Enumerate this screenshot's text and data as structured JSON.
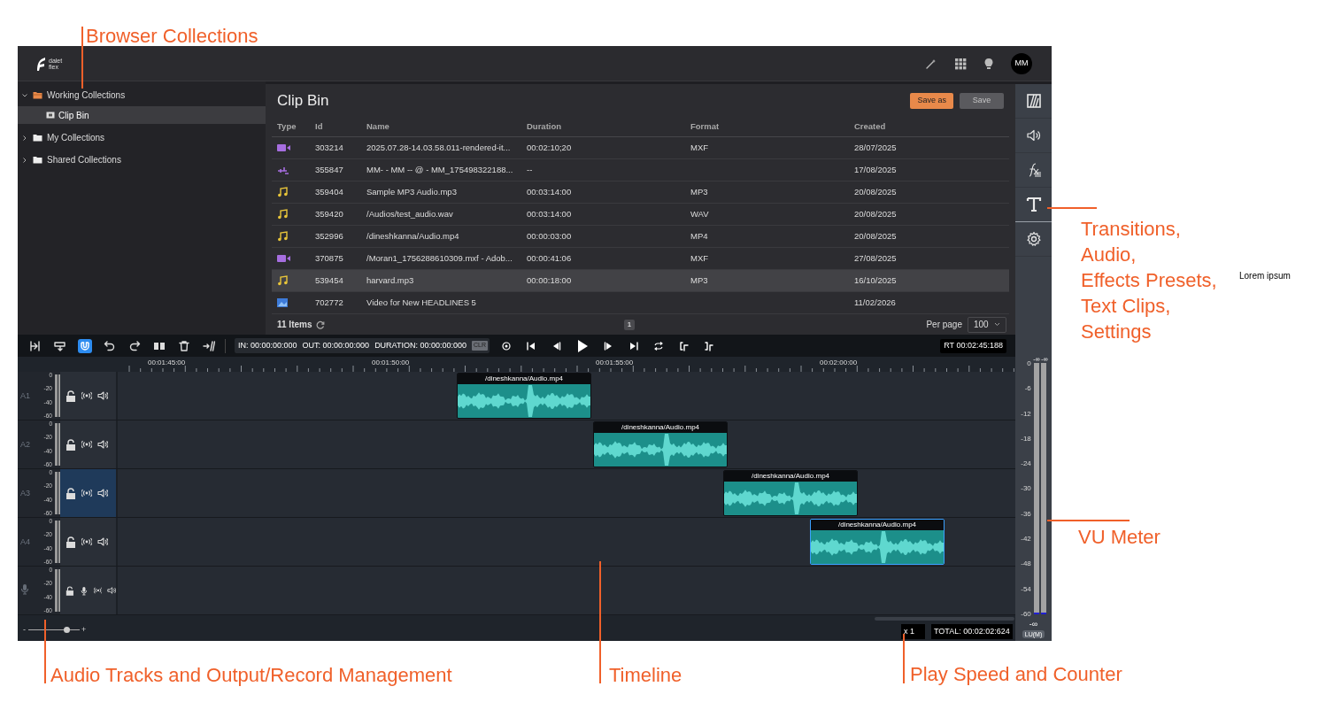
{
  "header": {
    "logo": {
      "line_1": "dalet",
      "line_2": "flex"
    },
    "avatar": "MM"
  },
  "sidebar": {
    "items": [
      {
        "label": "Working Collections",
        "expanded": true,
        "selected": false,
        "children": [
          {
            "label": "Clip Bin",
            "selected": true
          }
        ]
      },
      {
        "label": "My Collections",
        "expanded": false,
        "selected": false
      },
      {
        "label": "Shared Collections",
        "expanded": false,
        "selected": false
      }
    ]
  },
  "clip_bin": {
    "title": "Clip Bin",
    "buttons": [
      {
        "label": "Save as",
        "disabled": false
      },
      {
        "label": "Save",
        "disabled": true
      }
    ],
    "table": {
      "columns": [
        "Type",
        "Id",
        "Name",
        "Duration",
        "Format",
        "Created"
      ],
      "rows": [
        {
          "kind": "video",
          "id": "303214",
          "name": "2025.07.28-14.03.58.011-rendered-it...",
          "duration": "00:02:10;20",
          "format": "MXF",
          "created": "28/07/2025",
          "selected": false
        },
        {
          "kind": "sequence",
          "id": "355847",
          "name": "MM- - MM -- @ - MM_175498322188...",
          "duration": "--",
          "format": "",
          "created": "17/08/2025",
          "selected": false
        },
        {
          "kind": "audio",
          "id": "359404",
          "name": "Sample MP3 Audio.mp3",
          "duration": "00:03:14:00",
          "format": "MP3",
          "created": "20/08/2025",
          "selected": false
        },
        {
          "kind": "audio",
          "id": "359420",
          "name": "/Audios/test_audio.wav",
          "duration": "00:03:14:00",
          "format": "WAV",
          "created": "20/08/2025",
          "selected": false
        },
        {
          "kind": "audio",
          "id": "352996",
          "name": "/dineshkanna/Audio.mp4",
          "duration": "00:00:03:00",
          "format": "MP4",
          "created": "20/08/2025",
          "selected": false
        },
        {
          "kind": "video",
          "id": "370875",
          "name": "/Moran1_1756288610309.mxf - Adob...",
          "duration": "00:00:41:06",
          "format": "MXF",
          "created": "27/08/2025",
          "selected": false
        },
        {
          "kind": "audio",
          "id": "539454",
          "name": "harvard.mp3",
          "duration": "00:00:18:00",
          "format": "MP3",
          "created": "16/10/2025",
          "selected": true
        },
        {
          "kind": "image",
          "id": "702772",
          "name": "Video for New HEADLINES 5",
          "duration": "",
          "format": "",
          "created": "11/02/2026",
          "selected": false
        }
      ]
    },
    "footer": {
      "count": "11 Items",
      "page": "1",
      "per_page_label": "Per page",
      "per_page": "100"
    }
  },
  "toolbar": {
    "tools": [
      {
        "kind": "insert",
        "on": false
      },
      {
        "kind": "overwrite",
        "on": false
      },
      {
        "kind": "snap",
        "on": true
      },
      {
        "kind": "undo",
        "on": false
      },
      {
        "kind": "redo",
        "on": false
      },
      {
        "kind": "split",
        "on": false
      },
      {
        "kind": "delete",
        "on": false
      },
      {
        "kind": "ripple",
        "on": false
      }
    ],
    "timecode": {
      "in": "IN: 00:00:00:000",
      "out": "OUT: 00:00:00:000",
      "duration": "DURATION: 00:00:00:000",
      "clear": "CLR"
    },
    "transport": [
      {
        "kind": "record"
      },
      {
        "kind": "first"
      },
      {
        "kind": "step_back"
      },
      {
        "kind": "play"
      },
      {
        "kind": "step_forward"
      },
      {
        "kind": "last"
      },
      {
        "kind": "loop"
      },
      {
        "kind": "mark_in"
      },
      {
        "kind": "mark_out"
      }
    ],
    "rt": "RT 00:02:45:188"
  },
  "ruler": {
    "labels": [
      "00:01:45:00",
      "00:01:50:00",
      "00:01:55:00",
      "00:02:00:00"
    ]
  },
  "tracks": [
    {
      "kind": "audio",
      "label": "A1",
      "selected": false,
      "scale": [
        "0",
        "-20",
        "-40",
        "-60"
      ],
      "clips": [
        {
          "title": "/dineshkanna/Audio.mp4",
          "selected": false
        }
      ]
    },
    {
      "kind": "audio",
      "label": "A2",
      "selected": false,
      "scale": [
        "0",
        "-20",
        "-40",
        "-60"
      ],
      "clips": [
        {
          "title": "/dineshkanna/Audio.mp4",
          "selected": false
        }
      ]
    },
    {
      "kind": "audio",
      "label": "A3",
      "selected": true,
      "scale": [
        "0",
        "-20",
        "-40",
        "-60"
      ],
      "clips": [
        {
          "title": "/dineshkanna/Audio.mp4",
          "selected": false
        }
      ]
    },
    {
      "kind": "audio",
      "label": "A4",
      "selected": false,
      "scale": [
        "0",
        "-20",
        "-40",
        "-60"
      ],
      "clips": [
        {
          "title": "/dineshkanna/Audio.mp4",
          "selected": true
        }
      ]
    },
    {
      "kind": "record",
      "selected": false,
      "scale": [
        "0",
        "-20",
        "-40",
        "-60"
      ]
    }
  ],
  "bottom_bar": {
    "zoom_minus": "-",
    "zoom_level": {
      "level": 0.75
    },
    "zoom_plus": "+",
    "speed": "x 1",
    "total": "TOTAL: 00:02:02:624"
  },
  "rail": {
    "tools": [
      {
        "kind": "transitions"
      },
      {
        "kind": "audio"
      },
      {
        "kind": "effects"
      },
      {
        "kind": "text"
      },
      {
        "kind": "settings"
      }
    ]
  },
  "vu_meter": {
    "peaks": [
      "-∞",
      "-∞"
    ],
    "scale": [
      "0",
      "-6",
      "-12",
      "-18",
      "-24",
      "-30",
      "-36",
      "-42",
      "-48",
      "-54",
      "-60"
    ],
    "floor": "-∞",
    "unit": "LU(M)"
  },
  "annotations": [
    {
      "kind": "browser",
      "lines": [
        "Browser Collections"
      ]
    },
    {
      "kind": "rail",
      "lines": [
        "Transitions,",
        "Audio,",
        "Effects Presets,",
        "Text Clips,",
        "Settings"
      ]
    },
    {
      "kind": "vu",
      "lines": [
        "VU Meter"
      ]
    },
    {
      "kind": "tracks",
      "lines": [
        "Audio Tracks and Output/Record Management"
      ]
    },
    {
      "kind": "timeline",
      "lines": [
        "Timeline"
      ]
    },
    {
      "kind": "speed",
      "lines": [
        "Play Speed and Counter"
      ]
    },
    {
      "kind": "note",
      "lines": [
        "Lorem ipsum"
      ]
    }
  ]
}
